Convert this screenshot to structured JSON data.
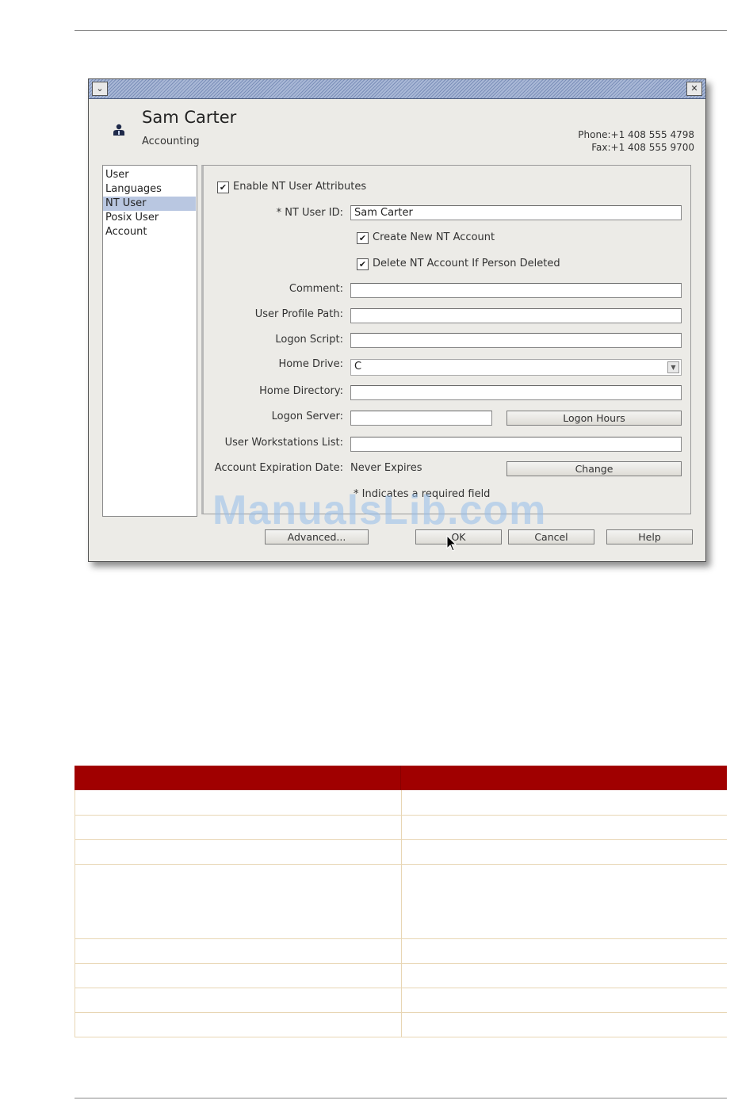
{
  "dialog": {
    "title_menu_icon": "chevron-down-icon",
    "close_icon": "close-icon",
    "header": {
      "icon": "user-icon",
      "name": "Sam Carter",
      "department": "Accounting",
      "phone": "Phone:+1 408 555 4798",
      "fax": "Fax:+1 408 555 9700"
    },
    "nav": {
      "items": [
        {
          "label": "User"
        },
        {
          "label": "Languages"
        },
        {
          "label": "NT User"
        },
        {
          "label": "Posix User"
        },
        {
          "label": "Account"
        }
      ],
      "selected": "NT User"
    },
    "form": {
      "enable_nt": {
        "label": "Enable NT User Attributes",
        "checked": true
      },
      "nt_user_id": {
        "label": "* NT User ID:",
        "value": "Sam Carter"
      },
      "create_nt": {
        "label": "Create New NT Account",
        "checked": true
      },
      "delete_nt": {
        "label": "Delete NT Account If Person Deleted",
        "checked": true
      },
      "comment": {
        "label": "Comment:",
        "value": ""
      },
      "profile_path": {
        "label": "User Profile Path:",
        "value": ""
      },
      "logon_script": {
        "label": "Logon Script:",
        "value": ""
      },
      "home_drive": {
        "label": "Home Drive:",
        "value": "C"
      },
      "home_directory": {
        "label": "Home Directory:",
        "value": ""
      },
      "logon_server": {
        "label": "Logon Server:",
        "value": ""
      },
      "logon_hours_button": "Logon Hours",
      "workstations": {
        "label": "User Workstations List:",
        "value": ""
      },
      "expiration": {
        "label": "Account Expiration Date:",
        "value": "Never Expires"
      },
      "change_button": "Change",
      "required_note": "* Indicates a required field"
    },
    "buttons": {
      "advanced": "Advanced...",
      "ok": "OK",
      "cancel": "Cancel",
      "help": "Help"
    },
    "watermark": "ManualsLib.com"
  },
  "table": {
    "headers": [
      "",
      ""
    ],
    "rows": [
      [
        "",
        ""
      ],
      [
        "",
        ""
      ],
      [
        "",
        ""
      ],
      [
        "",
        ""
      ],
      [
        "",
        ""
      ],
      [
        "",
        ""
      ],
      [
        "",
        ""
      ],
      [
        "",
        ""
      ]
    ]
  },
  "colors": {
    "table_header": "#a00000",
    "nav_selected": "#b9c7e1",
    "row_border": "#e8d6b4"
  }
}
